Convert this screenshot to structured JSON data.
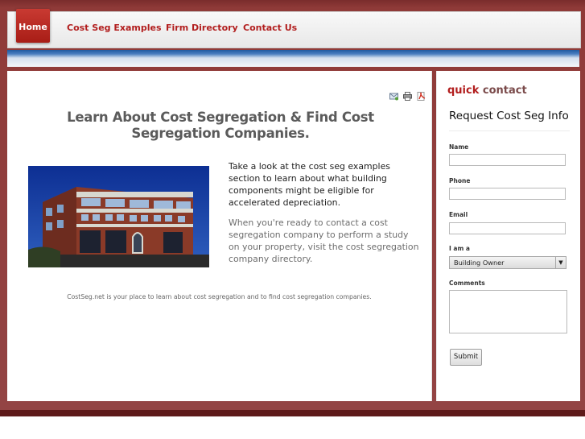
{
  "nav": {
    "home": "Home",
    "examples": "Cost Seg Examples",
    "directory": "Firm Directory",
    "contact": "Contact Us"
  },
  "tools": {
    "email_icon": "email-icon",
    "print_icon": "print-icon",
    "pdf_icon": "pdf-icon"
  },
  "main": {
    "headline": "Learn About Cost Segregation & Find Cost Segregation Companies.",
    "paragraph1": "Take a look at the cost seg examples section to learn about what building components might be eligible for accelerated depreciation.",
    "paragraph2": "When you're ready to contact a cost segregation company to perform a study on your property, visit the cost segregation company directory.",
    "footer_note": "CostSeg.net is your place to learn about cost segregation and to find cost segregation companies."
  },
  "sidebar": {
    "quick": "quick",
    "contact": " contact",
    "form_title": "Request Cost Seg Info",
    "name_label": "Name",
    "phone_label": "Phone",
    "email_label": "Email",
    "iam_label": "I am a",
    "iam_value": "Building Owner",
    "comments_label": "Comments",
    "submit_label": "Submit"
  },
  "colors": {
    "accent": "#b21e1e",
    "frame": "#8f3a38",
    "blue_bar": "#1f5aa1"
  }
}
